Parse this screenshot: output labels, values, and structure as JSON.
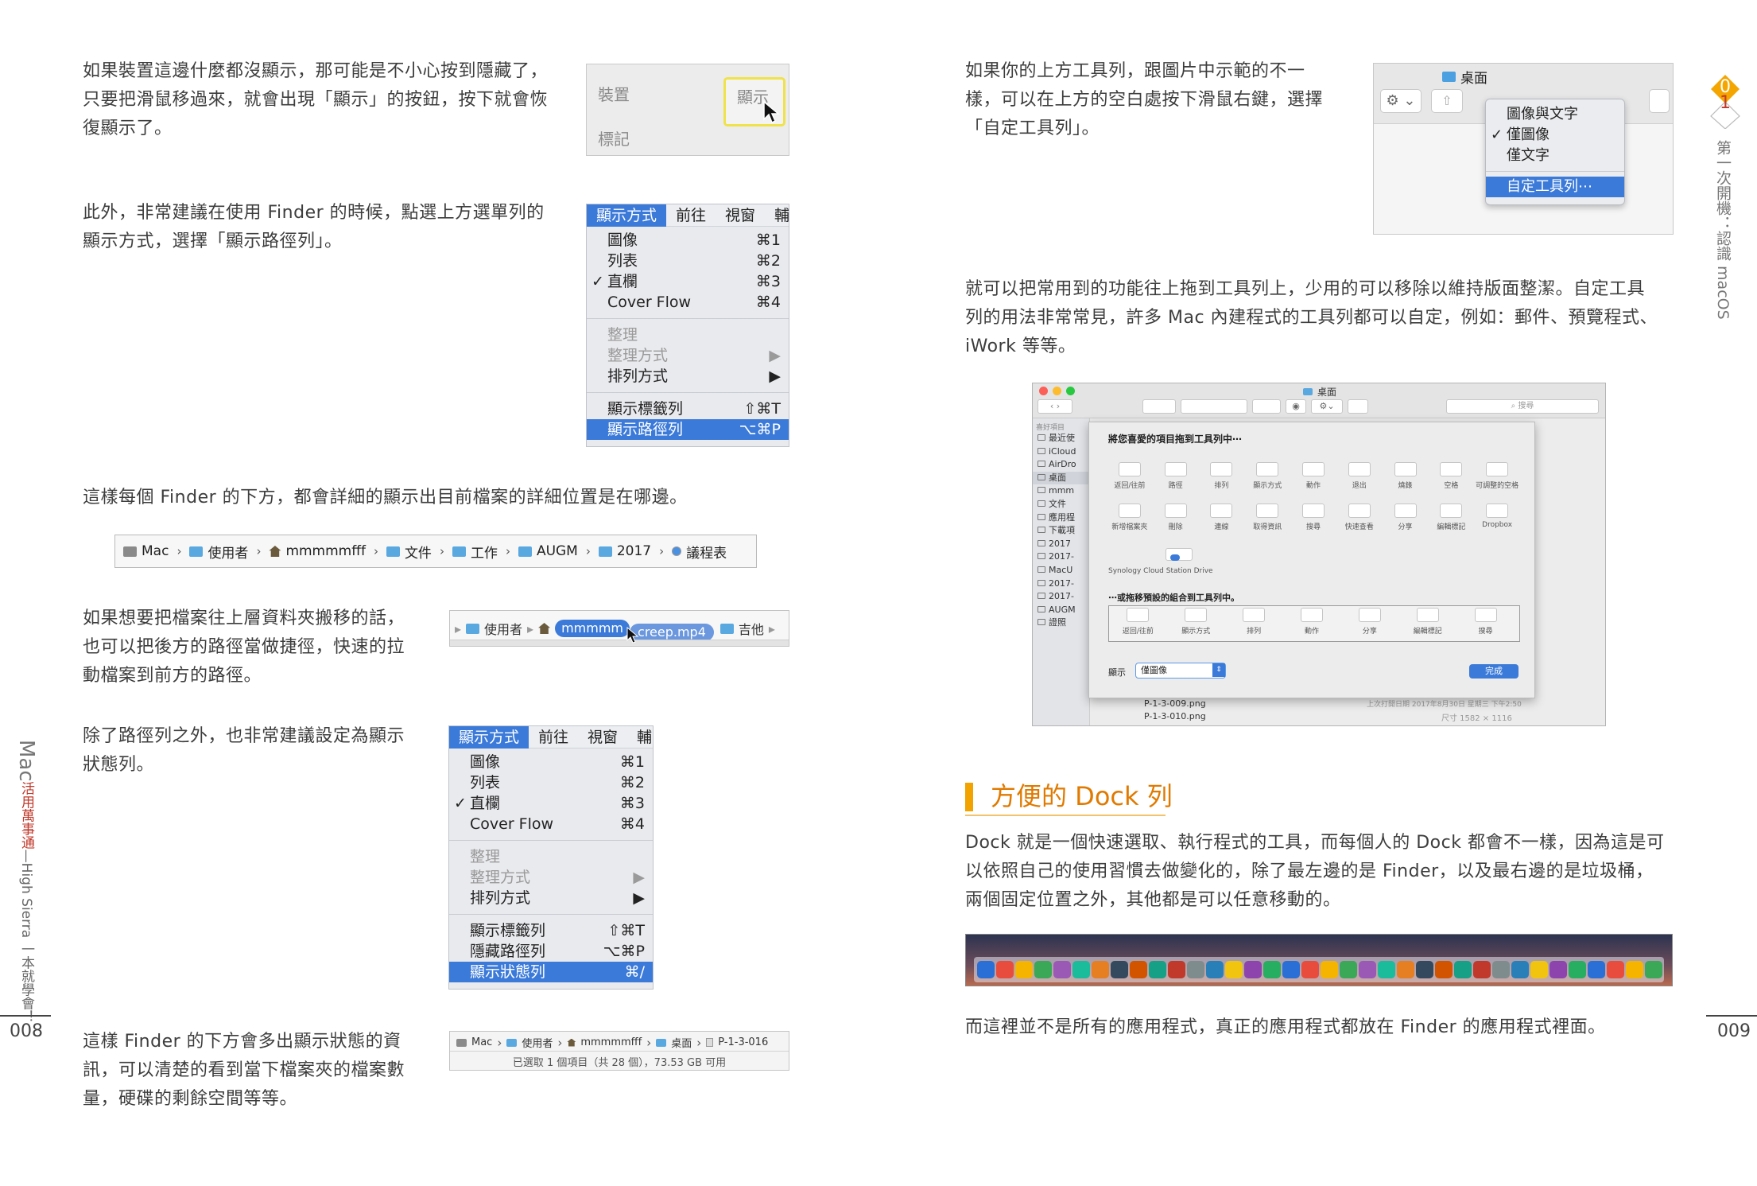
{
  "left_page": {
    "p1": [
      "如果裝置這邊什麼都沒顯示，那可能是不小心按到隱藏了，",
      "只要把滑鼠移過來，就會出現「顯示」的按鈕，按下就會恢",
      "復顯示了。"
    ],
    "shot1": {
      "item1": "裝置",
      "show_btn": "顯示",
      "item2": "標記"
    },
    "p2": [
      "此外，非常建議在使用 Finder 的時候，點選上方選單列的",
      "顯示方式，選擇「顯示路徑列」。"
    ],
    "menu1": {
      "bar": [
        "顯示方式",
        "前往",
        "視窗",
        "輔"
      ],
      "items": [
        {
          "label": "圖像",
          "key": "⌘1"
        },
        {
          "label": "列表",
          "key": "⌘2"
        },
        {
          "label": "直欄",
          "key": "⌘3",
          "check": "✓"
        },
        {
          "label": "Cover Flow",
          "key": "⌘4"
        }
      ],
      "items2": [
        {
          "label": "整理",
          "key": ""
        },
        {
          "label": "整理方式",
          "key": "▶"
        },
        {
          "label": "排列方式",
          "key": "▶"
        }
      ],
      "items3": [
        {
          "label": "顯示標籤列",
          "key": "⇧⌘T"
        },
        {
          "label": "顯示路徑列",
          "key": "⌥⌘P"
        }
      ]
    },
    "p3": "這樣每個 Finder 的下方，都會詳細的顯示出目前檔案的詳細位置是在哪邊。",
    "pathbar": [
      "Mac",
      "使用者",
      "mmmmmfff",
      "文件",
      "工作",
      "AUGM",
      "2017",
      "議程表"
    ],
    "p4": [
      "如果想要把檔案往上層資料夾搬移的話，",
      "也可以把後方的路徑當做捷徑，快速的拉",
      "動檔案到前方的路徑。"
    ],
    "drag": {
      "a": "使用者",
      "b": "mmmmm",
      "c": "creep.mp4",
      "d": "吉他"
    },
    "p5": [
      "除了路徑列之外，也非常建議設定為顯示",
      "狀態列。"
    ],
    "menu2": {
      "bar": [
        "顯示方式",
        "前往",
        "視窗",
        "輔"
      ],
      "items": [
        {
          "label": "圖像",
          "key": "⌘1"
        },
        {
          "label": "列表",
          "key": "⌘2"
        },
        {
          "label": "直欄",
          "key": "⌘3",
          "check": "✓"
        },
        {
          "label": "Cover Flow",
          "key": "⌘4"
        }
      ],
      "items2": [
        {
          "label": "整理",
          "key": ""
        },
        {
          "label": "整理方式",
          "key": "▶"
        },
        {
          "label": "排列方式",
          "key": "▶"
        }
      ],
      "items3": [
        {
          "label": "顯示標籤列",
          "key": "⇧⌘T"
        },
        {
          "label": "隱藏路徑列",
          "key": "⌥⌘P"
        },
        {
          "label": "顯示狀態列",
          "key": "⌘/"
        }
      ]
    },
    "p6": [
      "這樣 Finder 的下方會多出顯示狀態的資",
      "訊，可以清楚的看到當下檔案夾的檔案數",
      "量，硬碟的剩餘空間等等。"
    ],
    "statusbar": {
      "path": [
        "Mac",
        "使用者",
        "mmmmmfff",
        "桌面",
        "P-1-3-016"
      ],
      "status": "已選取 1 個項目（共 28 個），73.53 GB 可用"
    },
    "side_title": {
      "mac": "Mac",
      "red": "活用萬事通",
      "rest": "—High Sierra 一本就學會！"
    },
    "page": "008"
  },
  "right_page": {
    "p1": [
      "如果你的上方工具列，跟圖片中示範的不一",
      "樣，可以在上方的空白處按下滑鼠右鍵，選擇",
      "「自定工具列」。"
    ],
    "ctx": {
      "title": "桌面",
      "items": [
        "圖像與文字",
        "僅圖像",
        "僅文字"
      ],
      "check": "✓",
      "custom": "自定工具列⋯"
    },
    "p2": [
      "就可以把常用到的功能往上拖到工具列上，少用的可以移除以維持版面整潔。自定工具",
      "列的用法非常常見，許多 Mac 內建程式的工具列都可以自定，例如：郵件、預覽程式、",
      "iWork 等等。"
    ],
    "custom": {
      "window_title": "桌面",
      "search": "搜尋",
      "drag_title": "將您喜愛的項目拖到工具列中⋯",
      "row1": [
        "返回/往前",
        "路徑",
        "排列",
        "顯示方式",
        "動作",
        "退出",
        "燒錄",
        "空格",
        "可調整的空格"
      ],
      "row2": [
        "新增檔案夾",
        "刪除",
        "連線",
        "取得資訊",
        "搜尋",
        "快速查看",
        "分享",
        "編輯標記",
        "Dropbox"
      ],
      "synology": "Synology Cloud Station Drive",
      "default_title": "⋯或拖移預設的組合到工具列中。",
      "row3": [
        "返回/往前",
        "顯示方式",
        "排列",
        "動作",
        "分享",
        "編輯標記",
        "搜尋"
      ],
      "show_label": "顯示",
      "show_value": "僅圖像",
      "done": "完成",
      "sidebar_head": "喜好項目",
      "sidebar": [
        "最近使",
        "iCloud",
        "AirDro",
        "桌面",
        "mmm",
        "文件",
        "應用程",
        "下載項",
        "2017",
        "2017-",
        "MacU",
        "2017-",
        "2017-",
        "AUGM",
        "證照"
      ],
      "files": [
        "P-1-3-009.png",
        "P-1-3-010.png"
      ],
      "info": "上次打開日期 2017年8月30日 星期三 下午2:50",
      "size": "尺寸 1582 × 1116"
    },
    "section_title": "方便的 Dock 列",
    "p3": [
      "Dock 就是一個快速選取、執行程式的工具，而每個人的 Dock 都會不一樣，因為這是可",
      "以依照自己的使用習慣去做變化的，除了最左邊的是 Finder，以及最右邊的是垃圾桶，",
      "兩個固定位置之外，其他都是可以任意移動的。"
    ],
    "p4": "而這裡並不是所有的應用程式，真正的應用程式都放在 Finder 的應用程式裡面。",
    "chapter": {
      "num": "01",
      "text": "第一次開機：認識 macOS"
    },
    "page": "009"
  },
  "colors": {
    "accent": "#e07a00",
    "menu_select": "#3b7ad9"
  }
}
